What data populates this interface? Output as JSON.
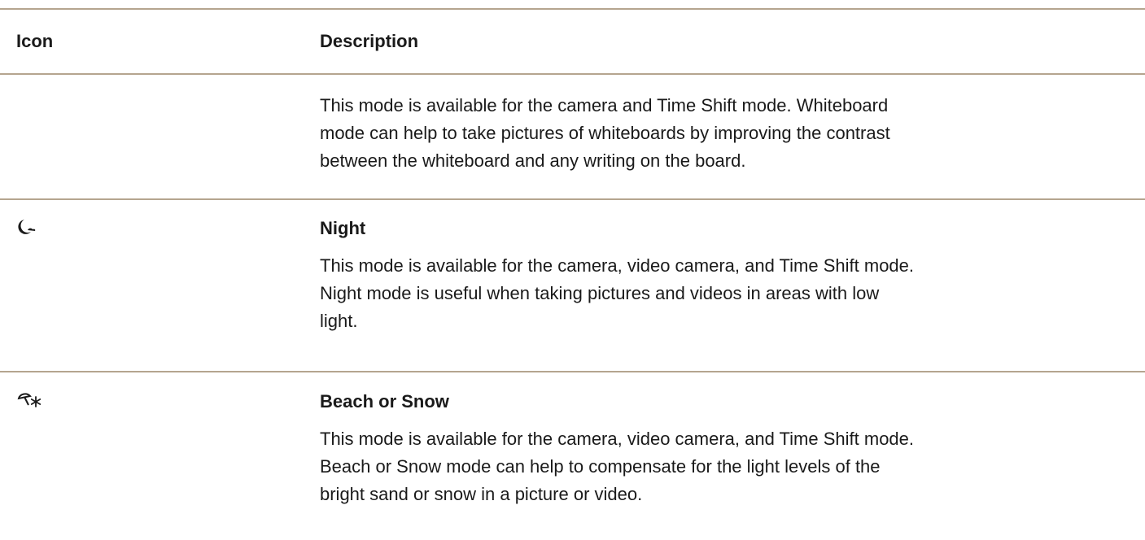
{
  "table": {
    "headers": {
      "icon": "Icon",
      "description": "Description"
    },
    "rows": [
      {
        "icon": "",
        "title": "",
        "lines": [
          "This mode is available for the camera and Time Shift mode. Whiteboard",
          "mode can help to take pictures of whiteboards by improving the contrast",
          "between the whiteboard and any writing on the board."
        ]
      },
      {
        "icon": "night-mode-icon",
        "title": "Night",
        "lines": [
          "This mode is available for the camera, video camera, and Time Shift mode.",
          "Night mode is useful when taking pictures and videos in areas with low",
          "light."
        ]
      },
      {
        "icon": "beach-snow-mode-icon",
        "title": "Beach or Snow",
        "lines": [
          "This mode is available for the camera, video camera, and Time Shift mode.",
          "Beach or Snow mode can help to compensate for the light levels of the",
          "bright sand or snow in a picture or video."
        ]
      }
    ]
  },
  "colors": {
    "rule": "#b5a58f",
    "text": "#1a1a1a"
  }
}
